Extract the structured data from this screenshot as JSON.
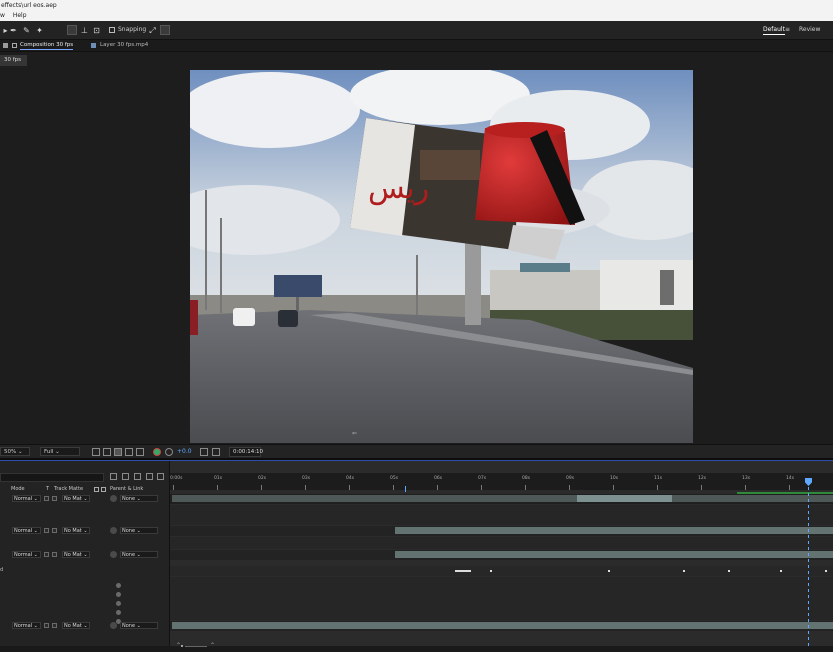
{
  "window": {
    "title": "effects\\url eos.aep"
  },
  "menu": {
    "items": [
      "w",
      "Help"
    ]
  },
  "toolbar": {
    "snapping_label": "Snapping",
    "workspaces": [
      {
        "label": "Default",
        "active": true
      },
      {
        "label": "Review",
        "active": false
      }
    ]
  },
  "panels": {
    "tabs": [
      {
        "label": "Composition 30 fps",
        "active": true
      },
      {
        "label": "Layer 30 fps.mp4",
        "active": false
      }
    ],
    "subtab": "30 fps"
  },
  "viewer_footer": {
    "zoom_value": "50%",
    "resolution_value": "Full",
    "exposure_value": "+0.0",
    "timecode": "0:00:14:10"
  },
  "timeline": {
    "columns": {
      "mode": "Mode",
      "t": "T",
      "track_matte": "Track Matte",
      "parent_link": "Parent & Link"
    },
    "ruler_labels": [
      "0:00s",
      "01s",
      "02s",
      "03s",
      "04s",
      "05s",
      "06s",
      "07s",
      "08s",
      "09s",
      "10s",
      "11s",
      "12s",
      "13s",
      "14s"
    ],
    "layers": [
      {
        "mode": "Normal",
        "matte": "No Mat",
        "parent": "None"
      },
      {
        "mode": "Normal",
        "matte": "No Mat",
        "parent": "None"
      },
      {
        "mode": "Normal",
        "matte": "No Mat",
        "parent": "None"
      },
      {
        "mode": "Normal",
        "matte": "No Mat",
        "parent": "None"
      }
    ],
    "fx_row_label": "d"
  },
  "colors": {
    "accent": "#5fa8ff",
    "layer_bar": "#627371",
    "green_bar": "#2e8b3a"
  }
}
